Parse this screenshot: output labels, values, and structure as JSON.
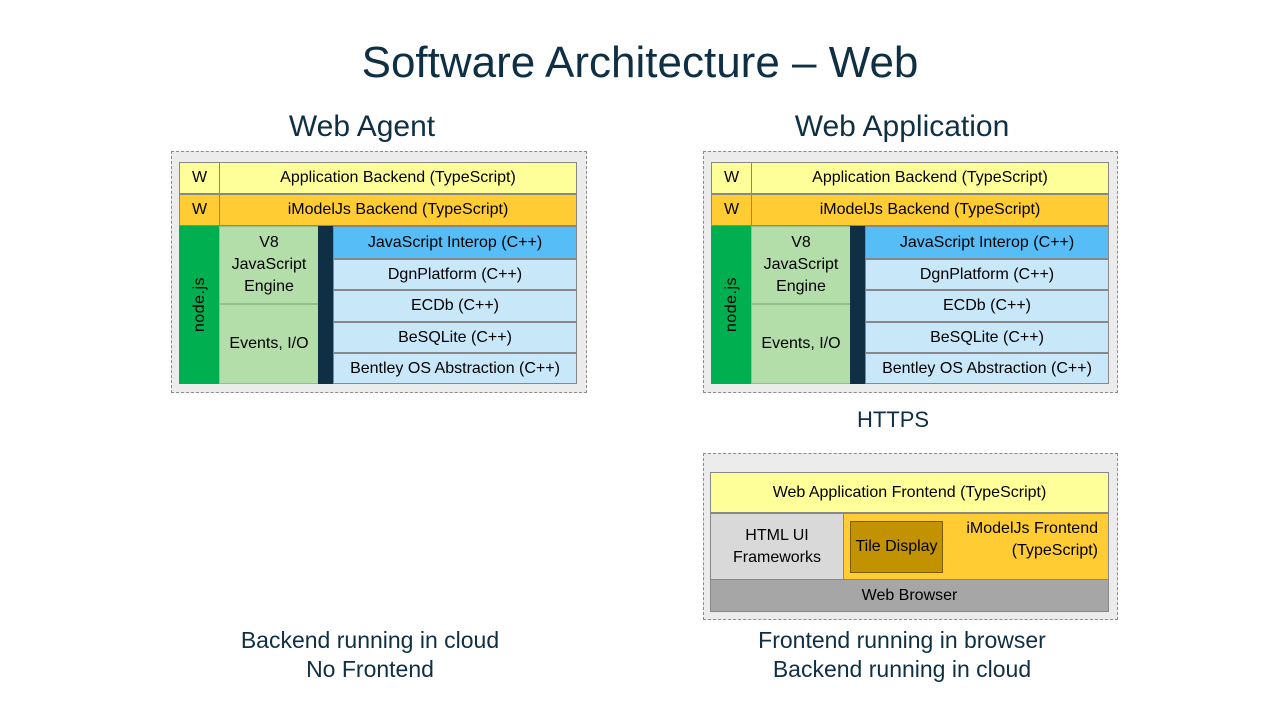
{
  "title": "Software Architecture – Web",
  "agent": {
    "heading": "Web Agent",
    "caption_line1": "Backend running in cloud",
    "caption_line2": "No Frontend"
  },
  "application": {
    "heading": "Web Application",
    "caption_line1": "Frontend running in browser",
    "caption_line2": "Backend running in cloud"
  },
  "backend_stack": {
    "w_label": "W",
    "app_backend": "Application Backend (TypeScript)",
    "imodeljs_backend": "iModelJs Backend (TypeScript)",
    "node": "node.js",
    "v8": "V8 JavaScript Engine",
    "events": "Events, I/O",
    "layers": [
      "JavaScript Interop (C++)",
      "DgnPlatform (C++)",
      "ECDb (C++)",
      "BeSQLite (C++)",
      "Bentley OS Abstraction (C++)"
    ]
  },
  "https": "HTTPS",
  "frontend_stack": {
    "app_frontend": "Web Application Frontend (TypeScript)",
    "html_ui": "HTML UI Frameworks",
    "imodeljs_frontend": "iModelJs Frontend (TypeScript)",
    "tile_display": "Tile Display",
    "browser": "Web Browser"
  },
  "colors": {
    "title": "#0e2f44",
    "app_layer": "#ffff99",
    "imodeljs_layer": "#ffcc33",
    "node": "#00b050",
    "v8": "#b3deaa",
    "interop": "#56bdf7",
    "native_layers": "#c8e8fa",
    "browser": "#a6a6a6"
  }
}
